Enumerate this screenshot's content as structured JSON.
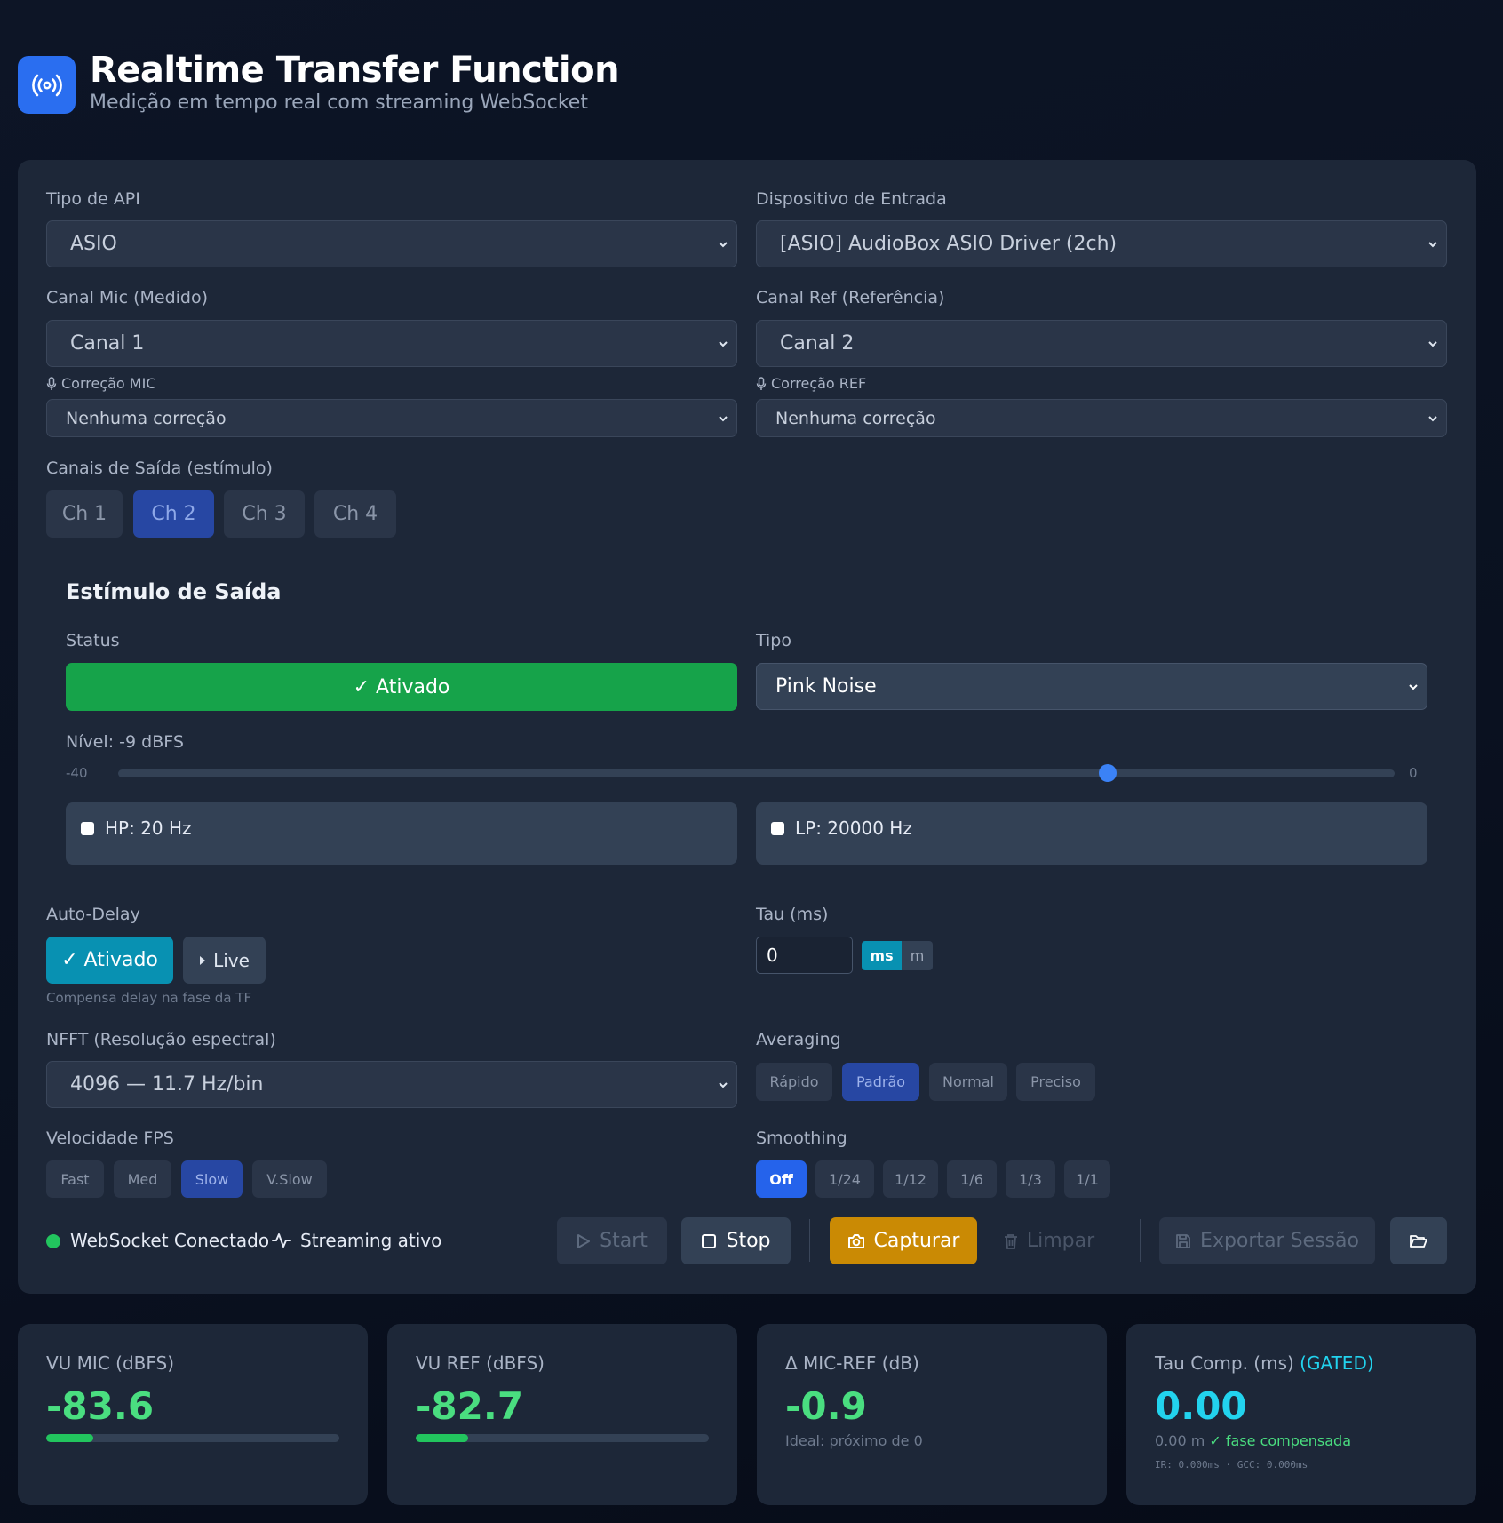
{
  "header": {
    "title": "Realtime Transfer Function",
    "subtitle": "Medição em tempo real com streaming WebSocket"
  },
  "config": {
    "api_label": "Tipo de API",
    "api_value": "ASIO",
    "device_label": "Dispositivo de Entrada",
    "device_value": "[ASIO] AudioBox ASIO Driver (2ch)",
    "mic_channel_label": "Canal Mic (Medido)",
    "mic_channel_value": "Canal 1",
    "ref_channel_label": "Canal Ref (Referência)",
    "ref_channel_value": "Canal 2",
    "mic_correction_label": "Correção MIC",
    "mic_correction_value": "Nenhuma correção",
    "ref_correction_label": "Correção REF",
    "ref_correction_value": "Nenhuma correção",
    "output_channels_label": "Canais de Saída (estímulo)",
    "output_channels": [
      "Ch 1",
      "Ch 2",
      "Ch 3",
      "Ch 4"
    ],
    "output_channels_active": "Ch 2"
  },
  "stimulus": {
    "title": "Estímulo de Saída",
    "status_label": "Status",
    "status_value": "✓ Ativado",
    "type_label": "Tipo",
    "type_value": "Pink Noise",
    "level_label": "Nível: -9 dBFS",
    "level_min": "-40",
    "level_max": "0",
    "level_value_dbfs": -9,
    "hp_label": "HP: 20 Hz",
    "hp_checked": false,
    "lp_label": "LP: 20000 Hz",
    "lp_checked": false
  },
  "delay": {
    "auto_delay_label": "Auto-Delay",
    "auto_delay_button": "✓ Ativado",
    "live_button": "Live",
    "auto_delay_hint": "Compensa delay na fase da TF",
    "tau_label": "Tau (ms)",
    "tau_value": "0",
    "unit_ms": "ms",
    "unit_m": "m"
  },
  "analysis": {
    "nfft_label": "NFFT (Resolução espectral)",
    "nfft_value": "4096 — 11.7 Hz/bin",
    "averaging_label": "Averaging",
    "averaging_options": [
      "Rápido",
      "Padrão",
      "Normal",
      "Preciso"
    ],
    "averaging_active": "Padrão",
    "fps_label": "Velocidade FPS",
    "fps_options": [
      "Fast",
      "Med",
      "Slow",
      "V.Slow"
    ],
    "fps_active": "Slow",
    "smoothing_label": "Smoothing",
    "smoothing_options": [
      "Off",
      "1/24",
      "1/12",
      "1/6",
      "1/3",
      "1/1"
    ],
    "smoothing_active": "Off"
  },
  "statusbar": {
    "websocket": "WebSocket Conectado",
    "streaming": "Streaming ativo",
    "start": "Start",
    "stop": "Stop",
    "capture": "Capturar",
    "clear": "Limpar",
    "export": "Exportar Sessão"
  },
  "meters": {
    "vu_mic_label": "VU MIC (dBFS)",
    "vu_mic_value": "-83.6",
    "vu_mic_fill": 0.16,
    "vu_ref_label": "VU REF (dBFS)",
    "vu_ref_value": "-82.7",
    "vu_ref_fill": 0.18,
    "delta_label": "Δ MIC-REF (dB)",
    "delta_value": "-0.9",
    "delta_note": "Ideal: próximo de 0",
    "tau_label": "Tau Comp. (ms)",
    "tau_tag": "(GATED)",
    "tau_value": "0.00",
    "tau_meters": "0.00 m",
    "tau_phase": "✓ fase compensada",
    "tau_detail": "IR: 0.000ms · GCC: 0.000ms"
  },
  "colors": {
    "accent_blue": "#2563eb",
    "active_chip": "#2747a3",
    "status_green": "#16a34a",
    "teal": "#0891b2",
    "capture_amber": "#ca8a04",
    "value_green": "#4ade80",
    "value_cyan": "#22d3ee"
  },
  "icons": {
    "logo": "broadcast-icon",
    "mic": "microphone-icon",
    "streaming": "activity-icon",
    "start": "play-icon",
    "stop": "stop-icon",
    "capture": "camera-icon",
    "clear": "trash-icon",
    "export": "save-icon",
    "open": "folder-open-icon"
  }
}
